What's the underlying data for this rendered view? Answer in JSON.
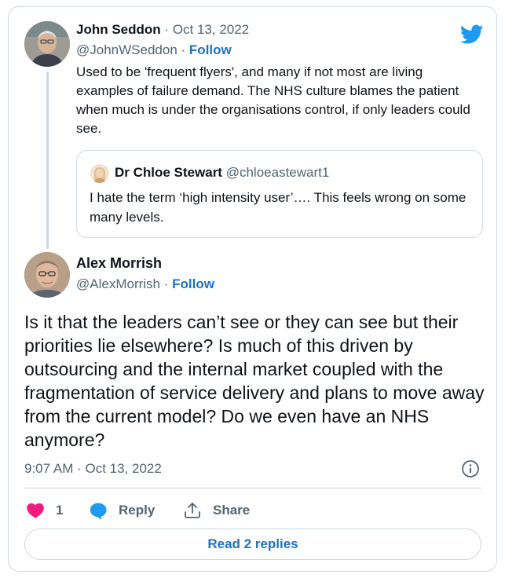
{
  "brand": {
    "accent": "#1d9bf0",
    "link": "#1d72c2",
    "like": "#f91880",
    "muted": "#536471"
  },
  "parent": {
    "name": "John Seddon",
    "separator": "·",
    "date": "Oct 13, 2022",
    "handle": "@JohnWSeddon",
    "follow": "Follow",
    "text": "Used to be 'frequent flyers', and many if not most are living examples of failure demand. The NHS culture blames the patient when much is under the organisations control, if only leaders could see."
  },
  "quote": {
    "name": "Dr Chloe Stewart",
    "handle": "@chloeastewart1",
    "text": "I hate the term ‘high intensity user’…. This feels wrong on some many levels."
  },
  "main": {
    "name": "Alex Morrish",
    "handle": "@AlexMorrish",
    "separator": "·",
    "follow": "Follow",
    "text": "Is it that the leaders can’t see or they can see but their priorities lie elsewhere? Is much of this driven by outsourcing and the internal market coupled with the fragmentation of service delivery and plans to move away from the current model? Do we even have an NHS anymore?",
    "timestamp": "9:07 AM · Oct 13, 2022"
  },
  "actions": {
    "like_count": "1",
    "reply_label": "Reply",
    "share_label": "Share"
  },
  "footer": {
    "read_replies": "Read 2 replies"
  },
  "icons": [
    "twitter-bird-icon",
    "heart-icon",
    "reply-bubble-icon",
    "share-icon",
    "info-icon"
  ]
}
